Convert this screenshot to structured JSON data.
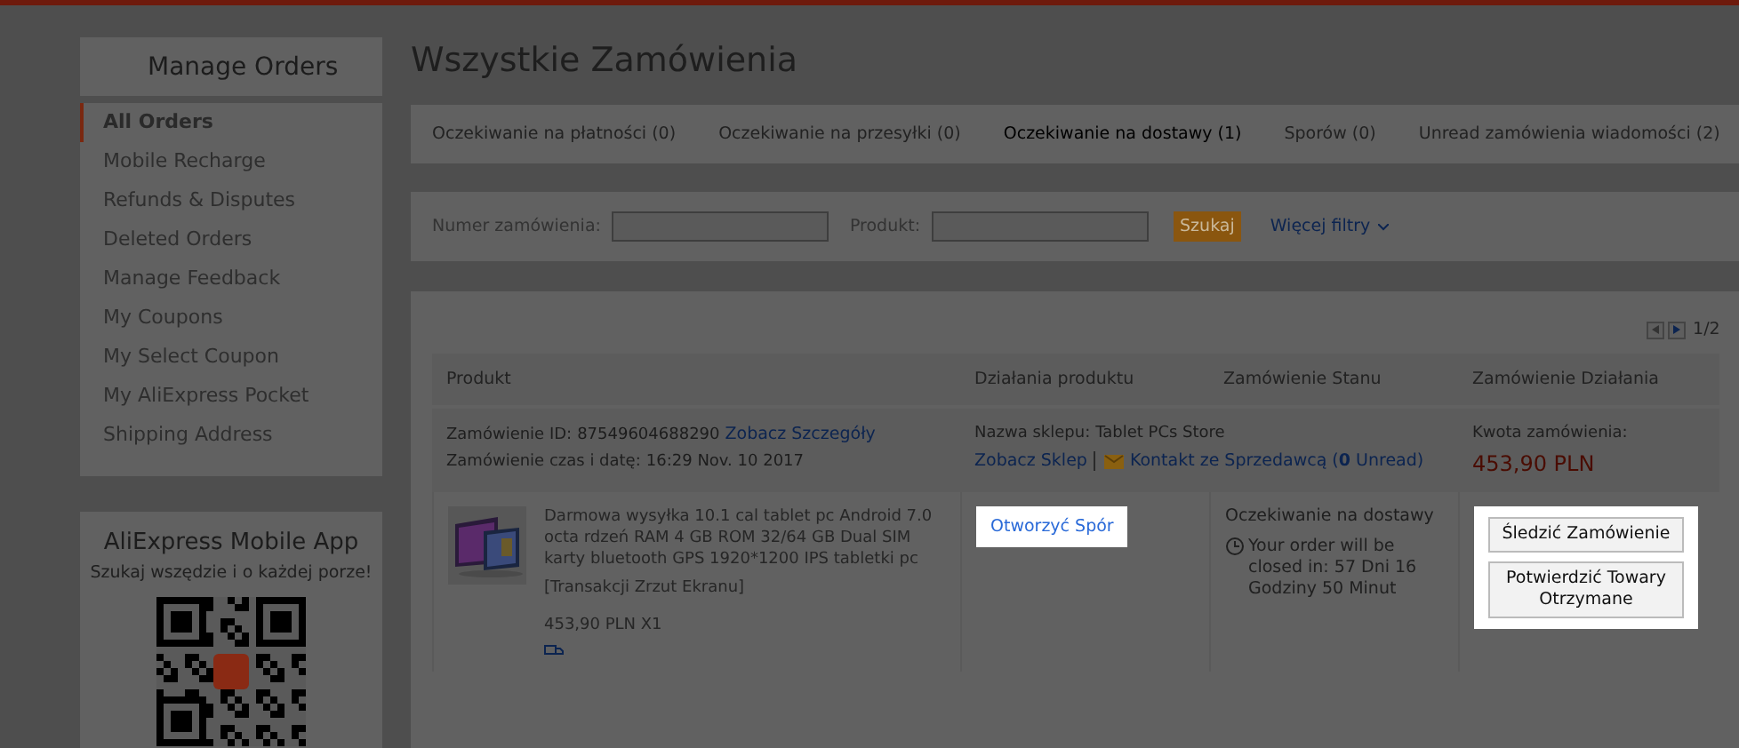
{
  "sidebar": {
    "title": "Manage Orders",
    "items": [
      {
        "label": "All Orders",
        "selected": true
      },
      {
        "label": "Mobile Recharge",
        "selected": false
      },
      {
        "label": "Refunds & Disputes",
        "selected": false
      },
      {
        "label": "Deleted Orders",
        "selected": false
      },
      {
        "label": "Manage Feedback",
        "selected": false
      },
      {
        "label": "My Coupons",
        "selected": false
      },
      {
        "label": "My Select Coupon",
        "selected": false
      },
      {
        "label": "My AliExpress Pocket",
        "selected": false
      },
      {
        "label": "Shipping Address",
        "selected": false
      }
    ]
  },
  "app_promo": {
    "title": "AliExpress Mobile App",
    "subtitle": "Szukaj wszędzie i o każdej porze!"
  },
  "page_title": "Wszystkie Zamówienia",
  "tabs": [
    {
      "label": "Oczekiwanie na płatności (0)",
      "selected": false
    },
    {
      "label": "Oczekiwanie na przesyłki (0)",
      "selected": false
    },
    {
      "label": "Oczekiwanie na dostawy (1)",
      "selected": true
    },
    {
      "label": "Sporów (0)",
      "selected": false
    },
    {
      "label": "Unread zamówienia wiadomości (2)",
      "selected": false
    }
  ],
  "filters": {
    "order_number_label": "Numer zamówienia:",
    "product_label": "Produkt:",
    "search_button": "Szukaj",
    "more_filters": "Więcej filtry"
  },
  "pager": "1/2",
  "table": {
    "columns": [
      "Produkt",
      "Działania produktu",
      "Zamówienie Stanu",
      "Zamówienie Działania"
    ],
    "order": {
      "id_label": "Zamówienie ID:",
      "id": "87549604688290",
      "details_link": "Zobacz Szczegóły",
      "time_label": "Zamówienie czas i datę:",
      "time": "16:29 Nov. 10 2017",
      "store_label": "Nazwa sklepu:",
      "store": "Tablet PCs Store",
      "store_link": "Zobacz Sklep",
      "contact_link": "Kontakt ze Sprzedawcą (**0** Unread)",
      "amount_label": "Kwota zamówienia:",
      "amount": "453,90 PLN"
    },
    "item": {
      "title": "Darmowa wysyłka 10.1 cal tablet pc Android 7.0 octa rdzeń RAM 4 GB ROM 32/64 GB Dual SIM karty bluetooth GPS 1920*1200 IPS tabletki pc",
      "snapshot": "[Transakcji Zrzut Ekranu]",
      "price": "453,90 PLN X1",
      "action": {
        "label": "Otworzyć Spór",
        "highlighted": true
      },
      "status": "Oczekiwanie na dostawy",
      "countdown": "Your order will be closed in: 57 Dni 16 Godziny 50 Minut",
      "buttons": {
        "labels": [
          "Śledzić Zamówienie",
          "Potwierdzić Towary Otrzymane"
        ],
        "highlighted": true
      }
    }
  }
}
